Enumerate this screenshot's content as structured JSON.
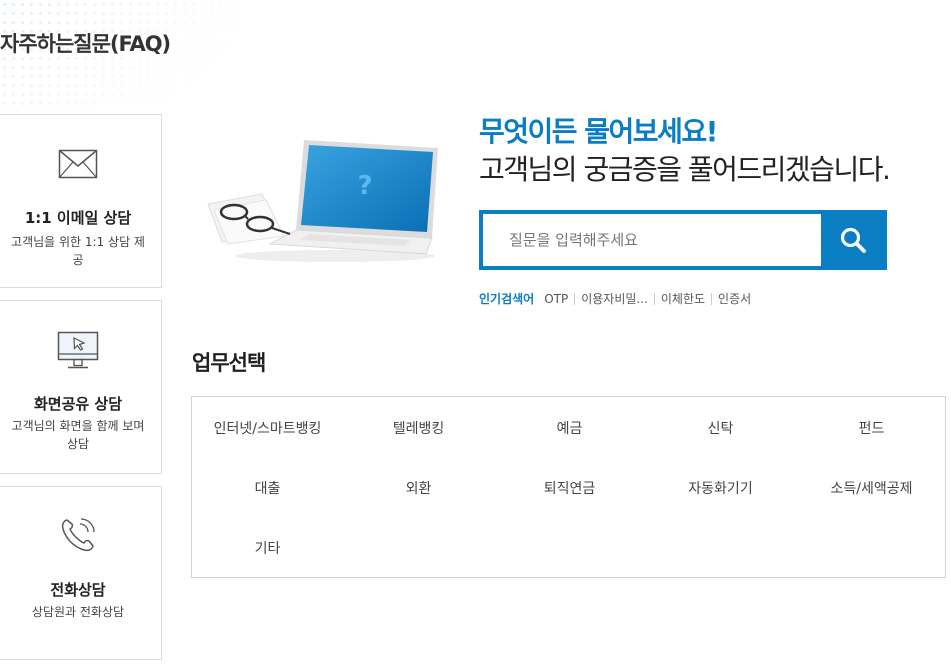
{
  "page": {
    "title": "자주하는질문(FAQ)"
  },
  "cards": [
    {
      "icon": "envelope-icon",
      "title": "1:1 이메일 상담",
      "desc": "고객님을 위한 1:1 상담 제공"
    },
    {
      "icon": "monitor-cursor-icon",
      "title": "화면공유 상담",
      "desc": "고객님의 화면을 함께 보며 상담"
    },
    {
      "icon": "phone-icon",
      "title": "전화상담",
      "desc": "상담원과 전화상담"
    }
  ],
  "hero": {
    "headline": "무엇이든 물어보세요!",
    "subline": "고객님의 궁금증을 풀어드리겠습니다."
  },
  "search": {
    "placeholder": "질문을 입력해주세요",
    "value": "",
    "button_icon": "search-icon"
  },
  "popular": {
    "label": "인기검색어",
    "keywords": [
      "OTP",
      "이용자비밀...",
      "이체한도",
      "인증서"
    ]
  },
  "business": {
    "title": "업무선택",
    "categories": [
      "인터넷/스마트뱅킹",
      "텔레뱅킹",
      "예금",
      "신탁",
      "펀드",
      "대출",
      "외환",
      "퇴직연금",
      "자동화기기",
      "소득/세액공제",
      "기타"
    ]
  },
  "colors": {
    "accent": "#0a7ec2",
    "text": "#333333",
    "border": "#dcdcdc"
  }
}
